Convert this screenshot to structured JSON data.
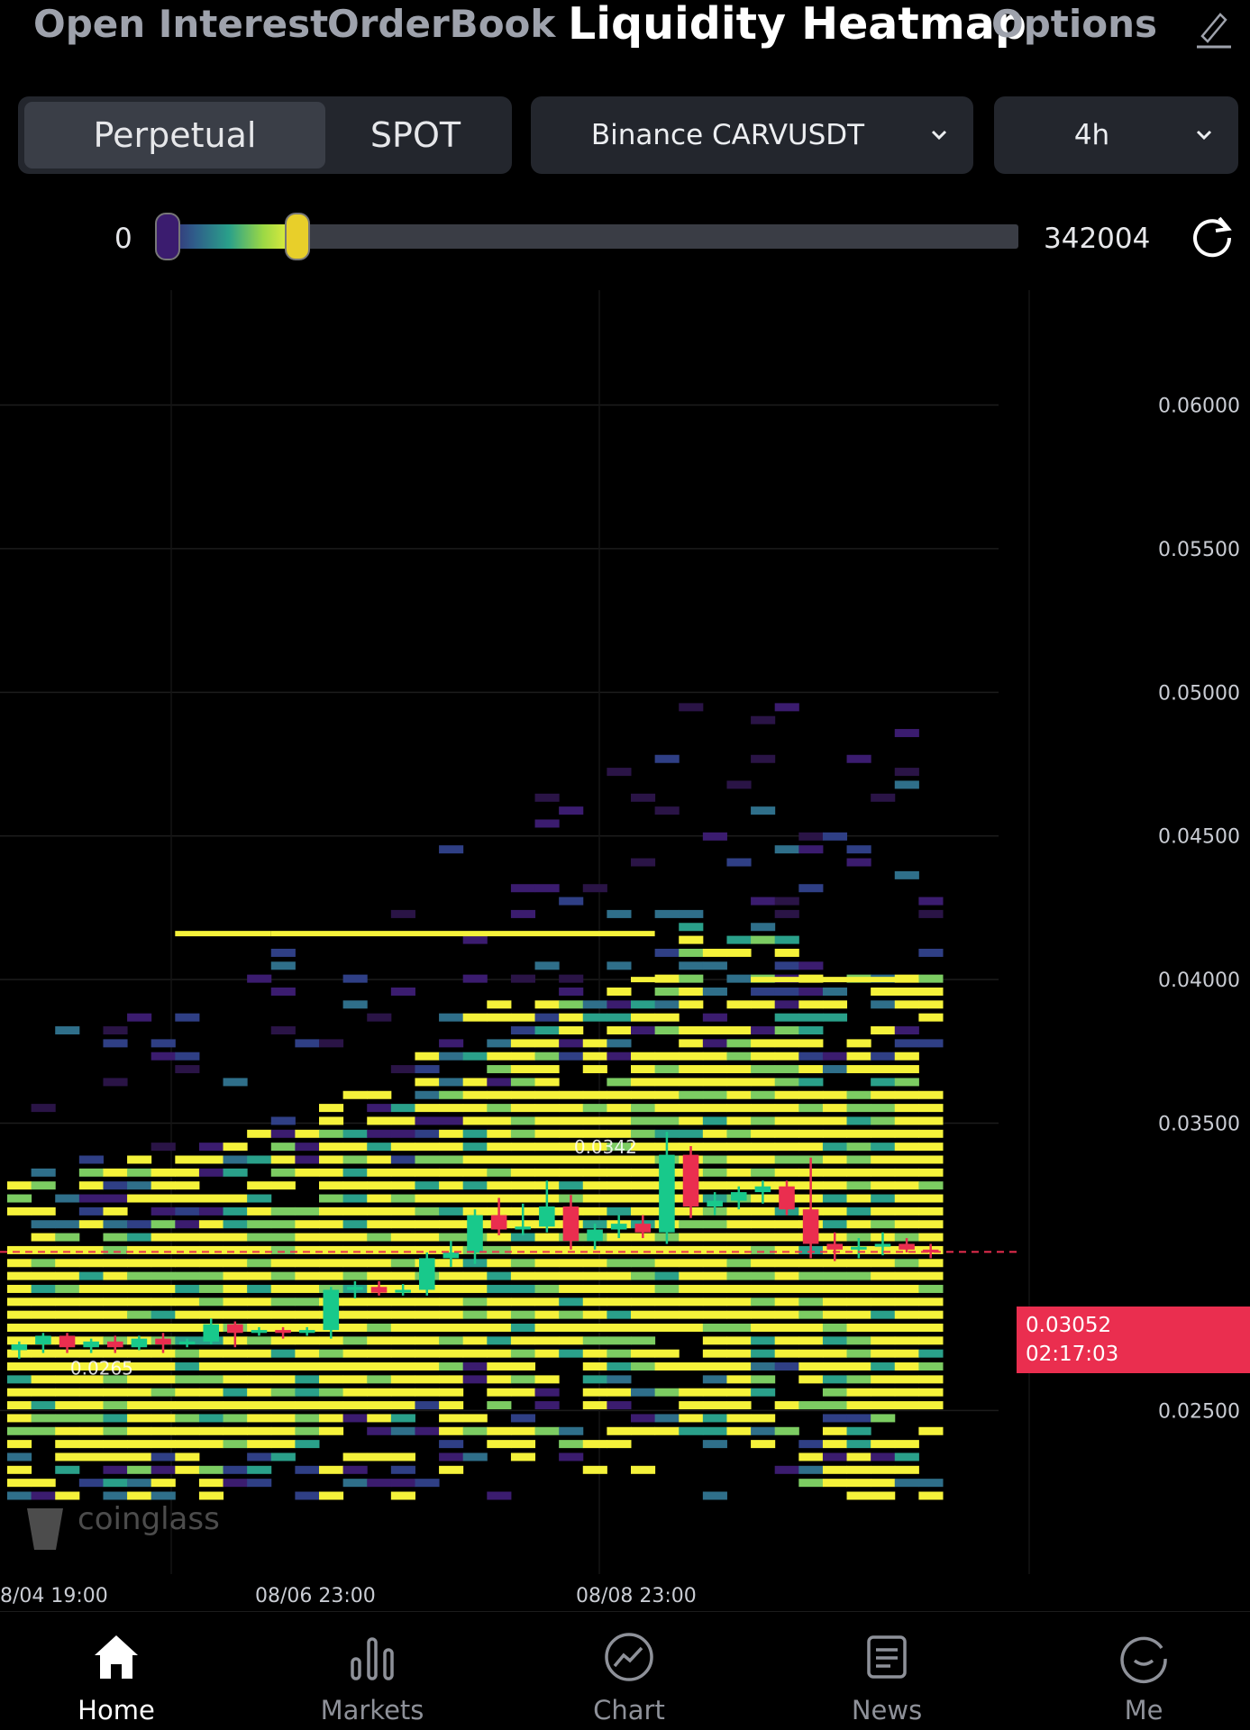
{
  "tabs": {
    "items": [
      {
        "label": "Open Interest",
        "active": false
      },
      {
        "label": "OrderBook",
        "active": false
      },
      {
        "label": "Liquidity Heatmap",
        "active": true
      },
      {
        "label": "Options",
        "active": false
      }
    ],
    "edit_icon": "pencil-icon"
  },
  "market_type": {
    "options": [
      "Perpetual",
      "SPOT"
    ],
    "selected": "Perpetual"
  },
  "exchange_pair": {
    "label": "Binance CARVUSDT",
    "icon": "chevron-down-icon"
  },
  "interval": {
    "label": "4h",
    "icon": "chevron-down-icon"
  },
  "range_slider": {
    "min_label": "0",
    "max_label": "342004",
    "low_value": 0,
    "high_value": 0.16,
    "refresh_icon": "refresh-icon"
  },
  "chart_data": {
    "type": "heatmap",
    "y_tick_labels": [
      "0.06000",
      "0.05500",
      "0.05000",
      "0.04500",
      "0.04000",
      "0.03500",
      "0.02500"
    ],
    "x_tick_labels": [
      "8/04 19:00",
      "08/06 23:00",
      "08/08 23:00"
    ],
    "ylim": [
      0.022,
      0.064
    ],
    "candles": [
      {
        "o": 0.0271,
        "h": 0.0274,
        "l": 0.0268,
        "c": 0.0273
      },
      {
        "o": 0.0273,
        "h": 0.0277,
        "l": 0.027,
        "c": 0.0276
      },
      {
        "o": 0.0276,
        "h": 0.0277,
        "l": 0.027,
        "c": 0.0272
      },
      {
        "o": 0.0272,
        "h": 0.0275,
        "l": 0.027,
        "c": 0.0274
      },
      {
        "o": 0.0274,
        "h": 0.0276,
        "l": 0.027,
        "c": 0.0272
      },
      {
        "o": 0.0272,
        "h": 0.0276,
        "l": 0.0271,
        "c": 0.0275
      },
      {
        "o": 0.0275,
        "h": 0.0277,
        "l": 0.027,
        "c": 0.0273
      },
      {
        "o": 0.0273,
        "h": 0.0275,
        "l": 0.0272,
        "c": 0.0274
      },
      {
        "o": 0.0274,
        "h": 0.0282,
        "l": 0.0273,
        "c": 0.028
      },
      {
        "o": 0.028,
        "h": 0.0281,
        "l": 0.0272,
        "c": 0.0277
      },
      {
        "o": 0.0277,
        "h": 0.0279,
        "l": 0.0276,
        "c": 0.0278
      },
      {
        "o": 0.0278,
        "h": 0.0279,
        "l": 0.0275,
        "c": 0.0277
      },
      {
        "o": 0.0277,
        "h": 0.0279,
        "l": 0.0276,
        "c": 0.0278
      },
      {
        "o": 0.0278,
        "h": 0.0293,
        "l": 0.0275,
        "c": 0.0292
      },
      {
        "o": 0.0292,
        "h": 0.0295,
        "l": 0.0289,
        "c": 0.0293
      },
      {
        "o": 0.0293,
        "h": 0.0295,
        "l": 0.029,
        "c": 0.0291
      },
      {
        "o": 0.0291,
        "h": 0.0294,
        "l": 0.029,
        "c": 0.0292
      },
      {
        "o": 0.0292,
        "h": 0.0305,
        "l": 0.029,
        "c": 0.0303
      },
      {
        "o": 0.0303,
        "h": 0.0309,
        "l": 0.03,
        "c": 0.0305
      },
      {
        "o": 0.0305,
        "h": 0.032,
        "l": 0.0301,
        "c": 0.0318
      },
      {
        "o": 0.0318,
        "h": 0.0324,
        "l": 0.0311,
        "c": 0.0313
      },
      {
        "o": 0.0313,
        "h": 0.0322,
        "l": 0.0311,
        "c": 0.0314
      },
      {
        "o": 0.0314,
        "h": 0.033,
        "l": 0.0312,
        "c": 0.0321
      },
      {
        "o": 0.0321,
        "h": 0.0325,
        "l": 0.0306,
        "c": 0.0309
      },
      {
        "o": 0.0309,
        "h": 0.0315,
        "l": 0.0306,
        "c": 0.0313
      },
      {
        "o": 0.0313,
        "h": 0.0318,
        "l": 0.031,
        "c": 0.0315
      },
      {
        "o": 0.0315,
        "h": 0.0318,
        "l": 0.031,
        "c": 0.0312
      },
      {
        "o": 0.0312,
        "h": 0.0347,
        "l": 0.0308,
        "c": 0.0339
      },
      {
        "o": 0.0339,
        "h": 0.0342,
        "l": 0.0317,
        "c": 0.0321
      },
      {
        "o": 0.0321,
        "h": 0.0326,
        "l": 0.0318,
        "c": 0.0323
      },
      {
        "o": 0.0323,
        "h": 0.0328,
        "l": 0.032,
        "c": 0.0326
      },
      {
        "o": 0.0326,
        "h": 0.033,
        "l": 0.0322,
        "c": 0.0328
      },
      {
        "o": 0.0328,
        "h": 0.033,
        "l": 0.0318,
        "c": 0.032
      },
      {
        "o": 0.032,
        "h": 0.0338,
        "l": 0.0303,
        "c": 0.0308
      },
      {
        "o": 0.0308,
        "h": 0.0312,
        "l": 0.0302,
        "c": 0.0306
      },
      {
        "o": 0.0306,
        "h": 0.031,
        "l": 0.0303,
        "c": 0.0307
      },
      {
        "o": 0.0307,
        "h": 0.0312,
        "l": 0.0304,
        "c": 0.0308
      },
      {
        "o": 0.0308,
        "h": 0.031,
        "l": 0.0305,
        "c": 0.0306
      },
      {
        "o": 0.0306,
        "h": 0.0308,
        "l": 0.0303,
        "c": 0.0305
      }
    ],
    "annotations": [
      {
        "text": "0.0342",
        "price": 0.0342,
        "candle": 22
      },
      {
        "text": "0.0265",
        "price": 0.0265,
        "candle": 1
      }
    ],
    "watermark": "coinglass",
    "heat_levels": [
      {
        "price": 0.0416,
        "from": 7,
        "to": 10,
        "level": 1
      },
      {
        "price": 0.0416,
        "from": 11,
        "to": 26,
        "level": 1
      },
      {
        "price": 0.04,
        "from": 26,
        "to": 27,
        "level": 1
      },
      {
        "price": 0.04,
        "from": 31,
        "to": 37,
        "level": 1
      }
    ],
    "current_price": {
      "value": "0.03052",
      "countdown": "02:17:03",
      "price": 0.03052
    }
  },
  "colors": {
    "up": "#18c98b",
    "down": "#ea2e4f",
    "heat_high": "#f5f23a",
    "heat_low": "#3b1c6f"
  },
  "bottom_nav": [
    {
      "label": "Home",
      "icon": "home-icon",
      "active": true
    },
    {
      "label": "Markets",
      "icon": "bar-chart-icon",
      "active": false
    },
    {
      "label": "Chart",
      "icon": "trend-chart-icon",
      "active": false
    },
    {
      "label": "News",
      "icon": "newspaper-icon",
      "active": false
    },
    {
      "label": "Me",
      "icon": "profile-icon",
      "active": false
    }
  ]
}
